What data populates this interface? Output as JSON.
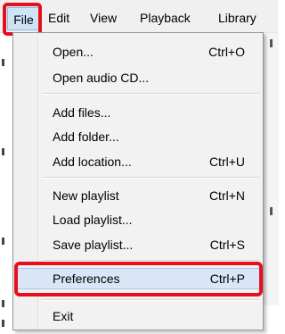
{
  "menubar": {
    "items": [
      {
        "label": "File"
      },
      {
        "label": "Edit"
      },
      {
        "label": "View"
      },
      {
        "label": "Playback"
      },
      {
        "label": "Library"
      }
    ]
  },
  "file_menu": {
    "items": [
      {
        "label": "Open...",
        "shortcut": "Ctrl+O"
      },
      {
        "label": "Open audio CD...",
        "shortcut": ""
      },
      {
        "label": "Add files...",
        "shortcut": ""
      },
      {
        "label": "Add folder...",
        "shortcut": ""
      },
      {
        "label": "Add location...",
        "shortcut": "Ctrl+U"
      },
      {
        "label": "New playlist",
        "shortcut": "Ctrl+N"
      },
      {
        "label": "Load playlist...",
        "shortcut": ""
      },
      {
        "label": "Save playlist...",
        "shortcut": "Ctrl+S"
      },
      {
        "label": "Preferences",
        "shortcut": "Ctrl+P"
      },
      {
        "label": "Exit",
        "shortcut": ""
      }
    ]
  },
  "annotations": {
    "color": "#e4101e"
  }
}
